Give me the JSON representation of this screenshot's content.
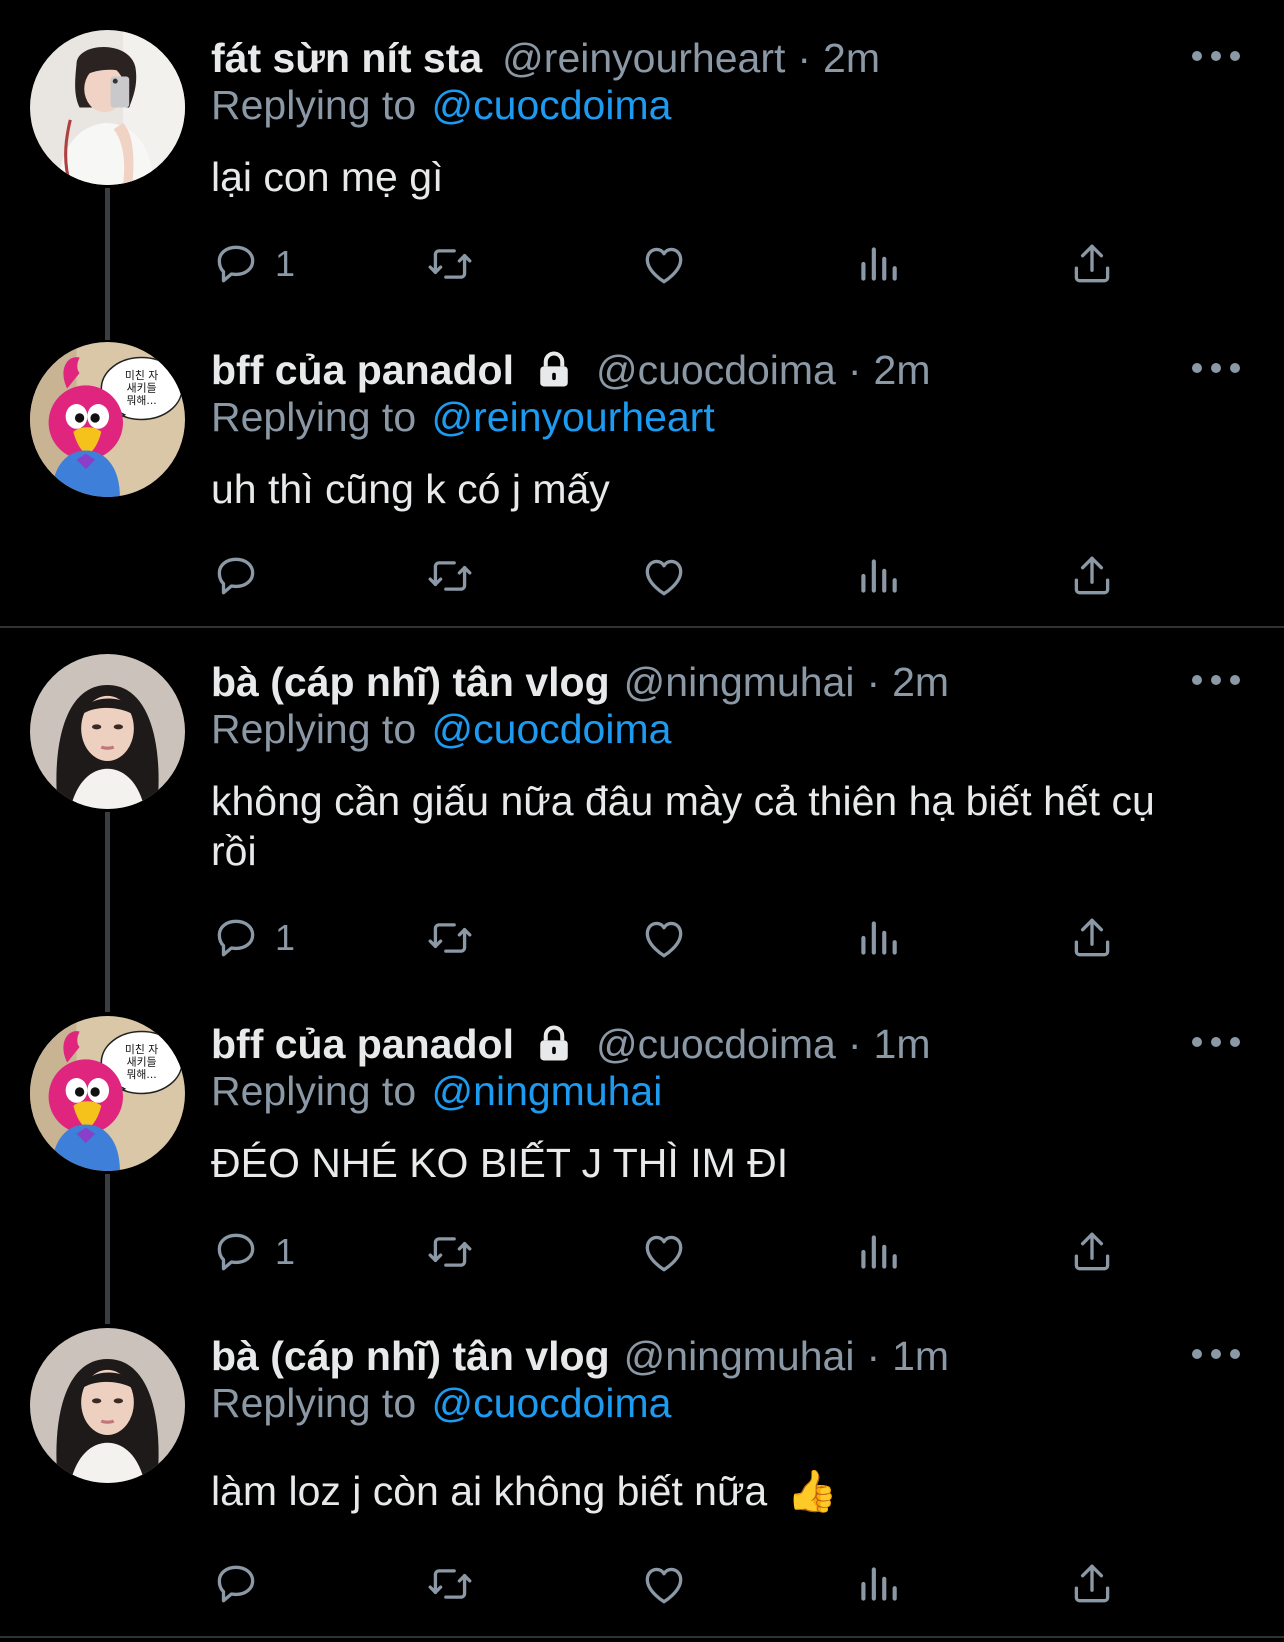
{
  "tweets": [
    {
      "name": "fát sừn nít sta",
      "locked": false,
      "handle": "@reinyourheart",
      "dot": "·",
      "time": "2m",
      "replying_prefix": "Replying to",
      "replying_to": "@cuocdoima",
      "text": "lại con mẹ gì",
      "reply_count": "1",
      "avatar": "avatar-girl-mirror-selfie"
    },
    {
      "name": "bff của panadol",
      "locked": true,
      "handle": "@cuocdoima",
      "dot": "·",
      "time": "2m",
      "replying_prefix": "Replying to",
      "replying_to": "@reinyourheart",
      "text": "uh thì cũng k có j mấy",
      "reply_count": "",
      "avatar": "avatar-pink-bird-cartoon",
      "avatar_bubble": [
        "미친 자",
        "새키들",
        "뭐해..."
      ]
    },
    {
      "name": "bà (cáp nhĩ) tân vlog",
      "locked": false,
      "handle": "@ningmuhai",
      "dot": "·",
      "time": "2m",
      "replying_prefix": "Replying to",
      "replying_to": "@cuocdoima",
      "text_line1": "không cần giấu nữa đâu mày cả thiên hạ biết hết cụ",
      "text_line2": "rồi",
      "reply_count": "1",
      "avatar": "avatar-girl-portrait"
    },
    {
      "name": "bff của panadol",
      "locked": true,
      "handle": "@cuocdoima",
      "dot": "·",
      "time": "1m",
      "replying_prefix": "Replying to",
      "replying_to": "@ningmuhai",
      "text": "ĐÉO NHÉ KO BIẾT J THÌ IM ĐI",
      "reply_count": "1",
      "avatar": "avatar-pink-bird-cartoon",
      "avatar_bubble": [
        "미친 자",
        "새키들",
        "뭐해..."
      ]
    },
    {
      "name": "bà (cáp nhĩ) tân vlog",
      "locked": false,
      "handle": "@ningmuhai",
      "dot": "·",
      "time": "1m",
      "replying_prefix": "Replying to",
      "replying_to": "@cuocdoima",
      "text": "làm loz j còn ai không biết nữa",
      "emoji": "👍",
      "reply_count": "",
      "avatar": "avatar-girl-portrait"
    }
  ],
  "icons": {
    "reply": "reply-icon",
    "retweet": "retweet-icon",
    "like": "like-icon",
    "views": "views-icon",
    "share": "share-icon",
    "more": "more-icon",
    "lock": "lock-icon"
  },
  "colors": {
    "background": "#000000",
    "text": "#e7e9ea",
    "muted": "#8b98a5",
    "link": "#1d9bf0",
    "separator": "#2f3336",
    "thread_line": "#3a3d41"
  }
}
